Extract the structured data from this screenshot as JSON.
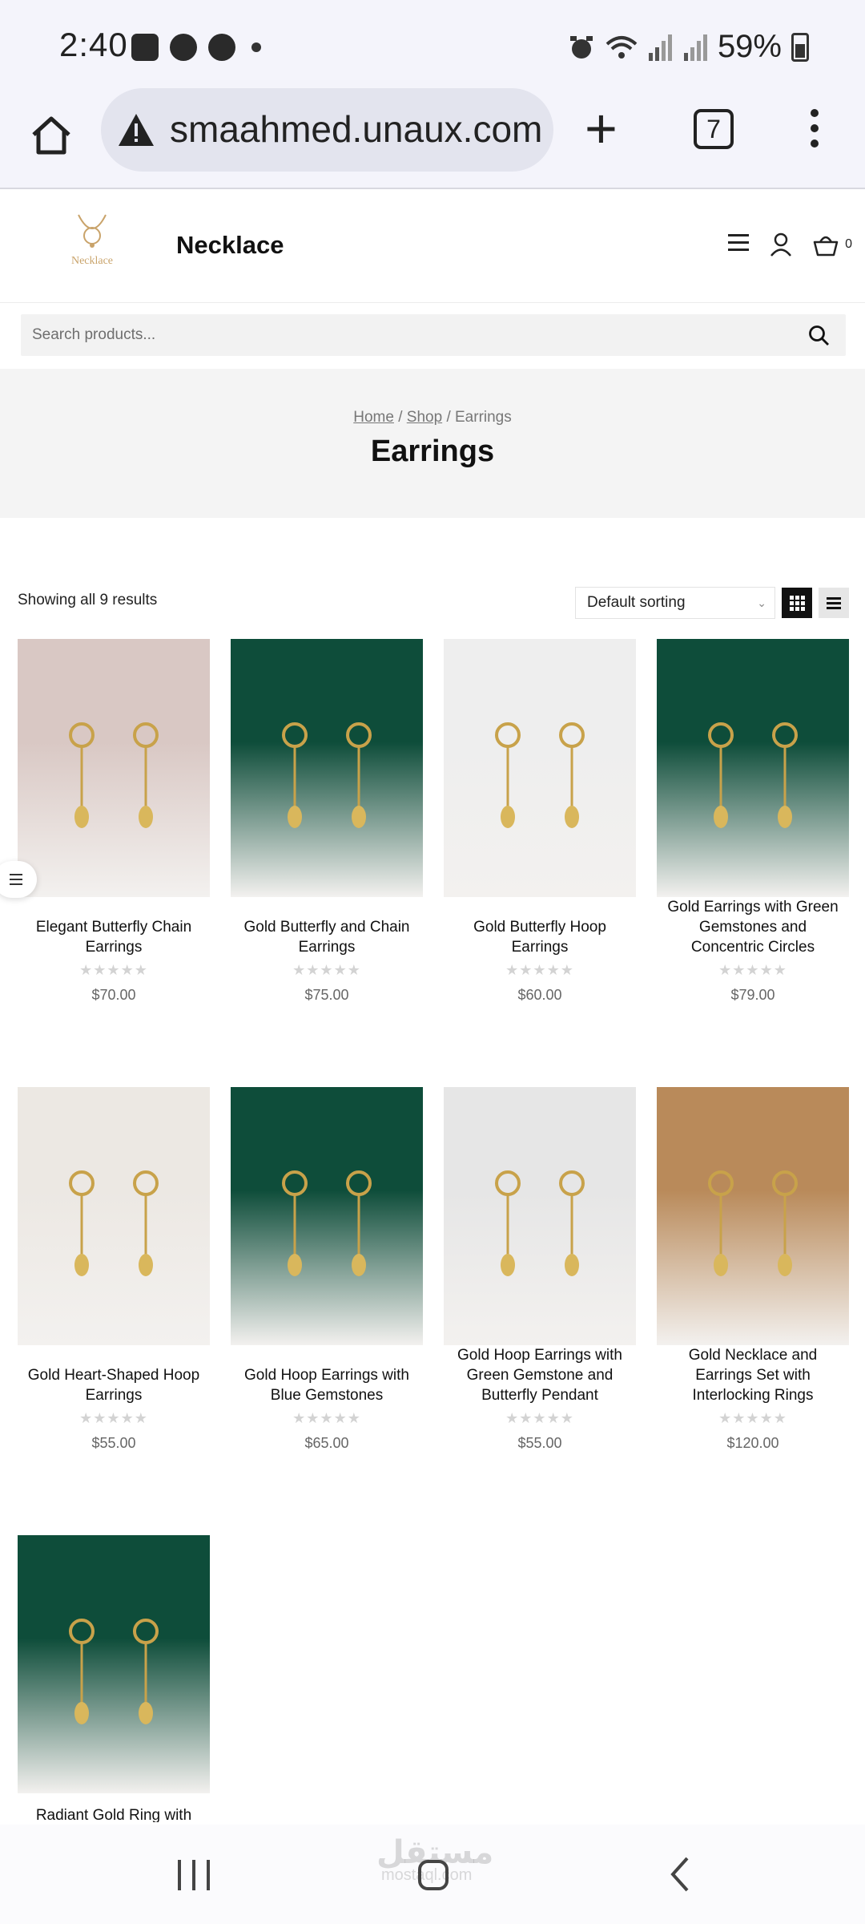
{
  "status_bar": {
    "time": "2:40",
    "icons": [
      "gallery-icon",
      "facebook-icon",
      "messenger-icon",
      "dot-icon"
    ],
    "right_icons": [
      "alarm-icon",
      "wifi-icon",
      "signal-icon",
      "signal-icon"
    ],
    "battery": "59%"
  },
  "browser": {
    "url": "smaahmed.unaux.com",
    "tabs_count": "7"
  },
  "header": {
    "logo_text": "Necklace",
    "site_title": "Necklace",
    "cart_count": "0"
  },
  "search": {
    "placeholder": "Search products..."
  },
  "breadcrumb": {
    "home": "Home",
    "sep1": "/",
    "shop": "Shop",
    "sep2": "/",
    "current": "Earrings"
  },
  "page_title": "Earrings",
  "toolbar": {
    "result_count": "Showing all 9 results",
    "sort_value": "Default sorting"
  },
  "products": [
    {
      "name": "Elegant Butterfly Chain Earrings",
      "price": "$70.00",
      "rating": 0,
      "bg": "#d9c8c4"
    },
    {
      "name": "Gold Butterfly and Chain Earrings",
      "price": "$75.00",
      "rating": 0,
      "bg": "#0e4d3a"
    },
    {
      "name": "Gold Butterfly Hoop Earrings",
      "price": "$60.00",
      "rating": 0,
      "bg": "#eeeeee"
    },
    {
      "name": "Gold Earrings with Green Gemstones and Concentric Circles",
      "price": "$79.00",
      "rating": 0,
      "bg": "#0e4d3a"
    },
    {
      "name": "Gold Heart-Shaped Hoop Earrings",
      "price": "$55.00",
      "rating": 0,
      "bg": "#ece8e3"
    },
    {
      "name": "Gold Hoop Earrings with Blue Gemstones",
      "price": "$65.00",
      "rating": 0,
      "bg": "#0e4d3a"
    },
    {
      "name": "Gold Hoop Earrings with Green Gemstone and Butterfly Pendant",
      "price": "$55.00",
      "rating": 0,
      "bg": "#e6e6e6"
    },
    {
      "name": "Gold Necklace and Earrings Set with Interlocking Rings",
      "price": "$120.00",
      "rating": 0,
      "bg": "#b98a5a"
    },
    {
      "name": "Radiant Gold Ring with",
      "price": "",
      "rating": 0,
      "bg": "#0e4d3a"
    }
  ],
  "watermark": "مستقل",
  "watermark_sub": "mostaql.com"
}
